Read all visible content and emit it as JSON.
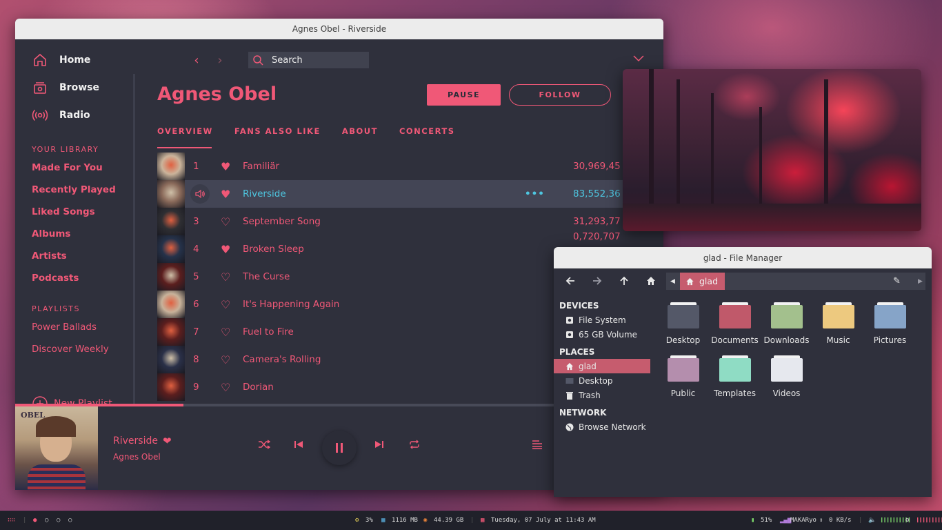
{
  "spotify": {
    "window_title": "Agnes Obel - Riverside",
    "nav": [
      {
        "label": "Home",
        "icon": "home-icon"
      },
      {
        "label": "Browse",
        "icon": "browse-icon"
      },
      {
        "label": "Radio",
        "icon": "radio-icon"
      }
    ],
    "library_heading": "YOUR LIBRARY",
    "library": [
      "Made For You",
      "Recently Played",
      "Liked Songs",
      "Albums",
      "Artists",
      "Podcasts"
    ],
    "playlists_heading": "PLAYLISTS",
    "playlists": [
      "Power Ballads",
      "Discover Weekly"
    ],
    "new_playlist": "New Playlist",
    "search_placeholder": "Search",
    "artist": "Agnes Obel",
    "pause_label": "PAUSE",
    "follow_label": "FOLLOW",
    "tabs": [
      "OVERVIEW",
      "FANS ALSO LIKE",
      "ABOUT",
      "CONCERTS"
    ],
    "tracks": [
      {
        "num": "1",
        "title": "Familiär",
        "plays": "30,969,45",
        "liked": true
      },
      {
        "num": "",
        "title": "Riverside",
        "plays": "83,552,36",
        "liked": true,
        "playing": true,
        "more": "•••"
      },
      {
        "num": "3",
        "title": "September Song",
        "plays": "31,293,77",
        "liked": false
      },
      {
        "num": "4",
        "title": "Broken Sleep",
        "plays": "0,720,707",
        "liked": true
      },
      {
        "num": "5",
        "title": "The Curse",
        "plays": "",
        "liked": false
      },
      {
        "num": "6",
        "title": "It's Happening Again",
        "plays": "",
        "liked": false
      },
      {
        "num": "7",
        "title": "Fuel to Fire",
        "plays": "",
        "liked": false
      },
      {
        "num": "8",
        "title": "Camera's Rolling",
        "plays": "",
        "liked": false
      },
      {
        "num": "9",
        "title": "Dorian",
        "plays": "",
        "liked": false
      }
    ],
    "progress": 0.26,
    "now_playing": {
      "title": "Riverside",
      "artist": "Agnes Obel",
      "cover_text": "OBEL"
    },
    "accent": "#f05877",
    "playing_color": "#4ec6e0"
  },
  "file_manager": {
    "window_title": "glad - File Manager",
    "path_crumb": "glad",
    "sections": [
      {
        "heading": "DEVICES",
        "items": [
          {
            "label": "File System",
            "icon": "drive-icon"
          },
          {
            "label": "65 GB Volume",
            "icon": "drive-icon"
          }
        ]
      },
      {
        "heading": "PLACES",
        "items": [
          {
            "label": "glad",
            "icon": "home-icon",
            "selected": true
          },
          {
            "label": "Desktop",
            "icon": "desktop-icon"
          },
          {
            "label": "Trash",
            "icon": "trash-icon"
          }
        ]
      },
      {
        "heading": "NETWORK",
        "items": [
          {
            "label": "Browse Network",
            "icon": "globe-icon"
          }
        ]
      }
    ],
    "folders": [
      {
        "label": "Desktop",
        "color": "#545868"
      },
      {
        "label": "Documents",
        "color": "#c0596a"
      },
      {
        "label": "Downloads",
        "color": "#a3c08d"
      },
      {
        "label": "Music",
        "color": "#edc97f"
      },
      {
        "label": "Pictures",
        "color": "#86a4c8"
      },
      {
        "label": "Public",
        "color": "#b48ead"
      },
      {
        "label": "Templates",
        "color": "#8fdcc4"
      },
      {
        "label": "Videos",
        "color": "#e6e8ee"
      }
    ],
    "accent": "#c65c6e"
  },
  "taskbar": {
    "cpu": "3%",
    "ram": "1116 MB",
    "disk": "44.39 GB",
    "datetime": "Tuesday, 07 July at 11:43 AM",
    "battery": "51%",
    "network_name": "MAKARyo",
    "net_speed": "0 KB/s"
  }
}
